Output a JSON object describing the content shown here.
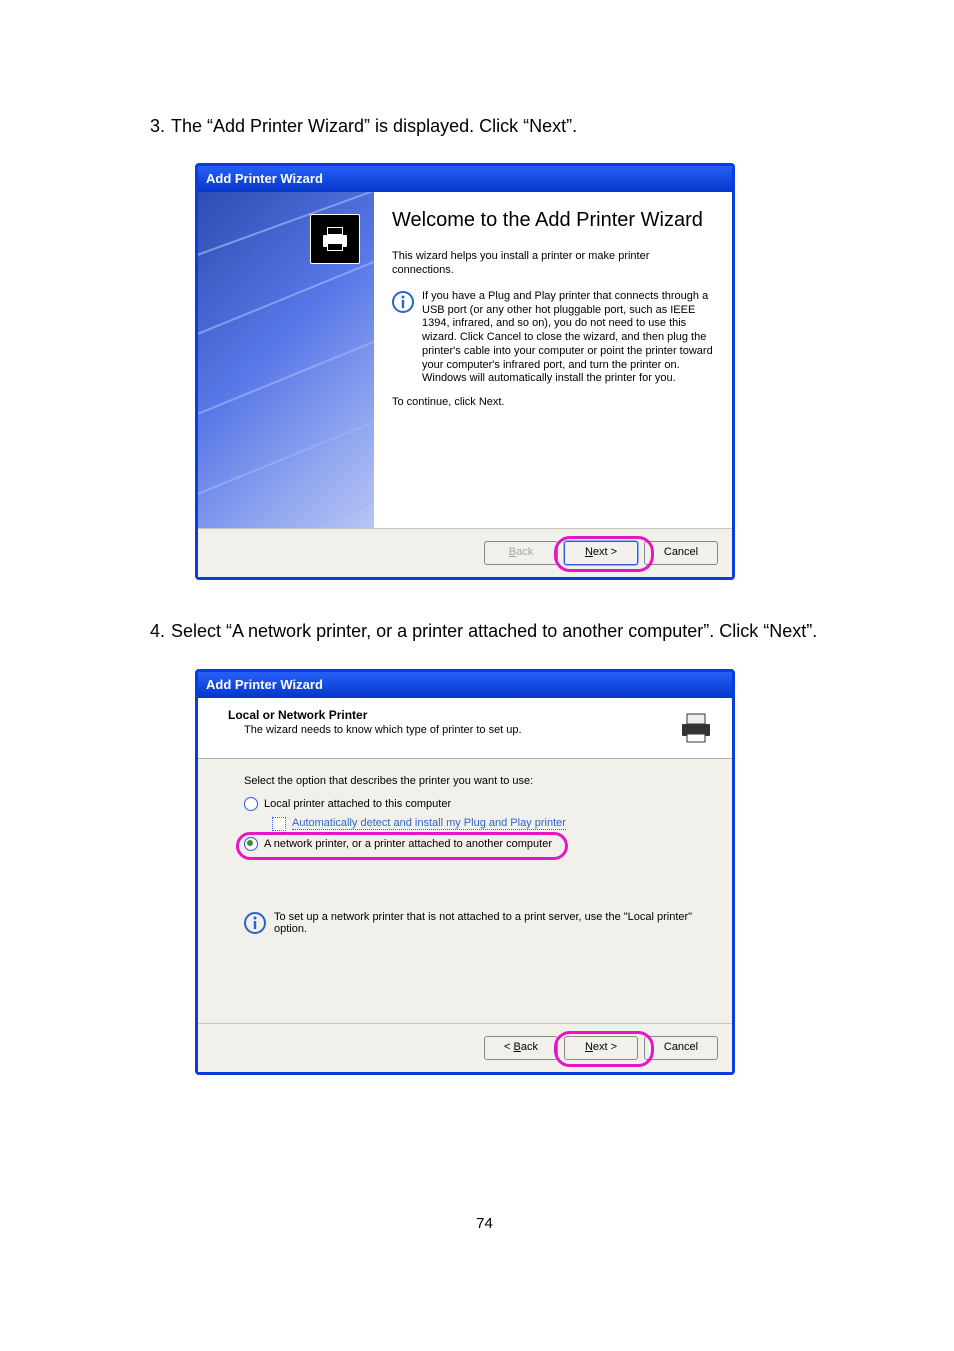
{
  "steps": {
    "s3": {
      "num": "3.",
      "text": "The “Add Printer Wizard” is displayed. Click “Next”."
    },
    "s4": {
      "num": "4.",
      "text": "Select “A network printer, or a printer attached to another computer”. Click “Next”."
    }
  },
  "wizard1": {
    "title": "Add Printer Wizard",
    "heading": "Welcome to the Add Printer Wizard",
    "intro": "This wizard helps you install a printer or make printer connections.",
    "info": "If you have a Plug and Play printer that connects through a USB port (or any other hot pluggable port, such as IEEE 1394, infrared, and so on), you do not need to use this wizard. Click Cancel to close the wizard, and then plug the printer's cable into your computer or point the printer toward your computer's infrared port, and turn the printer on. Windows will automatically install the printer for you.",
    "continue": "To continue, click Next.",
    "buttons": {
      "back": "< Back",
      "next": "Next >",
      "cancel": "Cancel"
    }
  },
  "wizard2": {
    "title": "Add Printer Wizard",
    "header": "Local or Network Printer",
    "sub": "The wizard needs to know which type of printer to set up.",
    "prompt": "Select the option that describes the printer you want to use:",
    "opt_local": "Local printer attached to this computer",
    "opt_auto": "Automatically detect and install my Plug and Play printer",
    "opt_net": "A network printer, or a printer attached to another computer",
    "tip": "To set up a network printer that is not attached to a print server, use the \"Local printer\" option.",
    "buttons": {
      "back": "< Back",
      "next": "Next >",
      "cancel": "Cancel"
    }
  },
  "page_number": "74"
}
